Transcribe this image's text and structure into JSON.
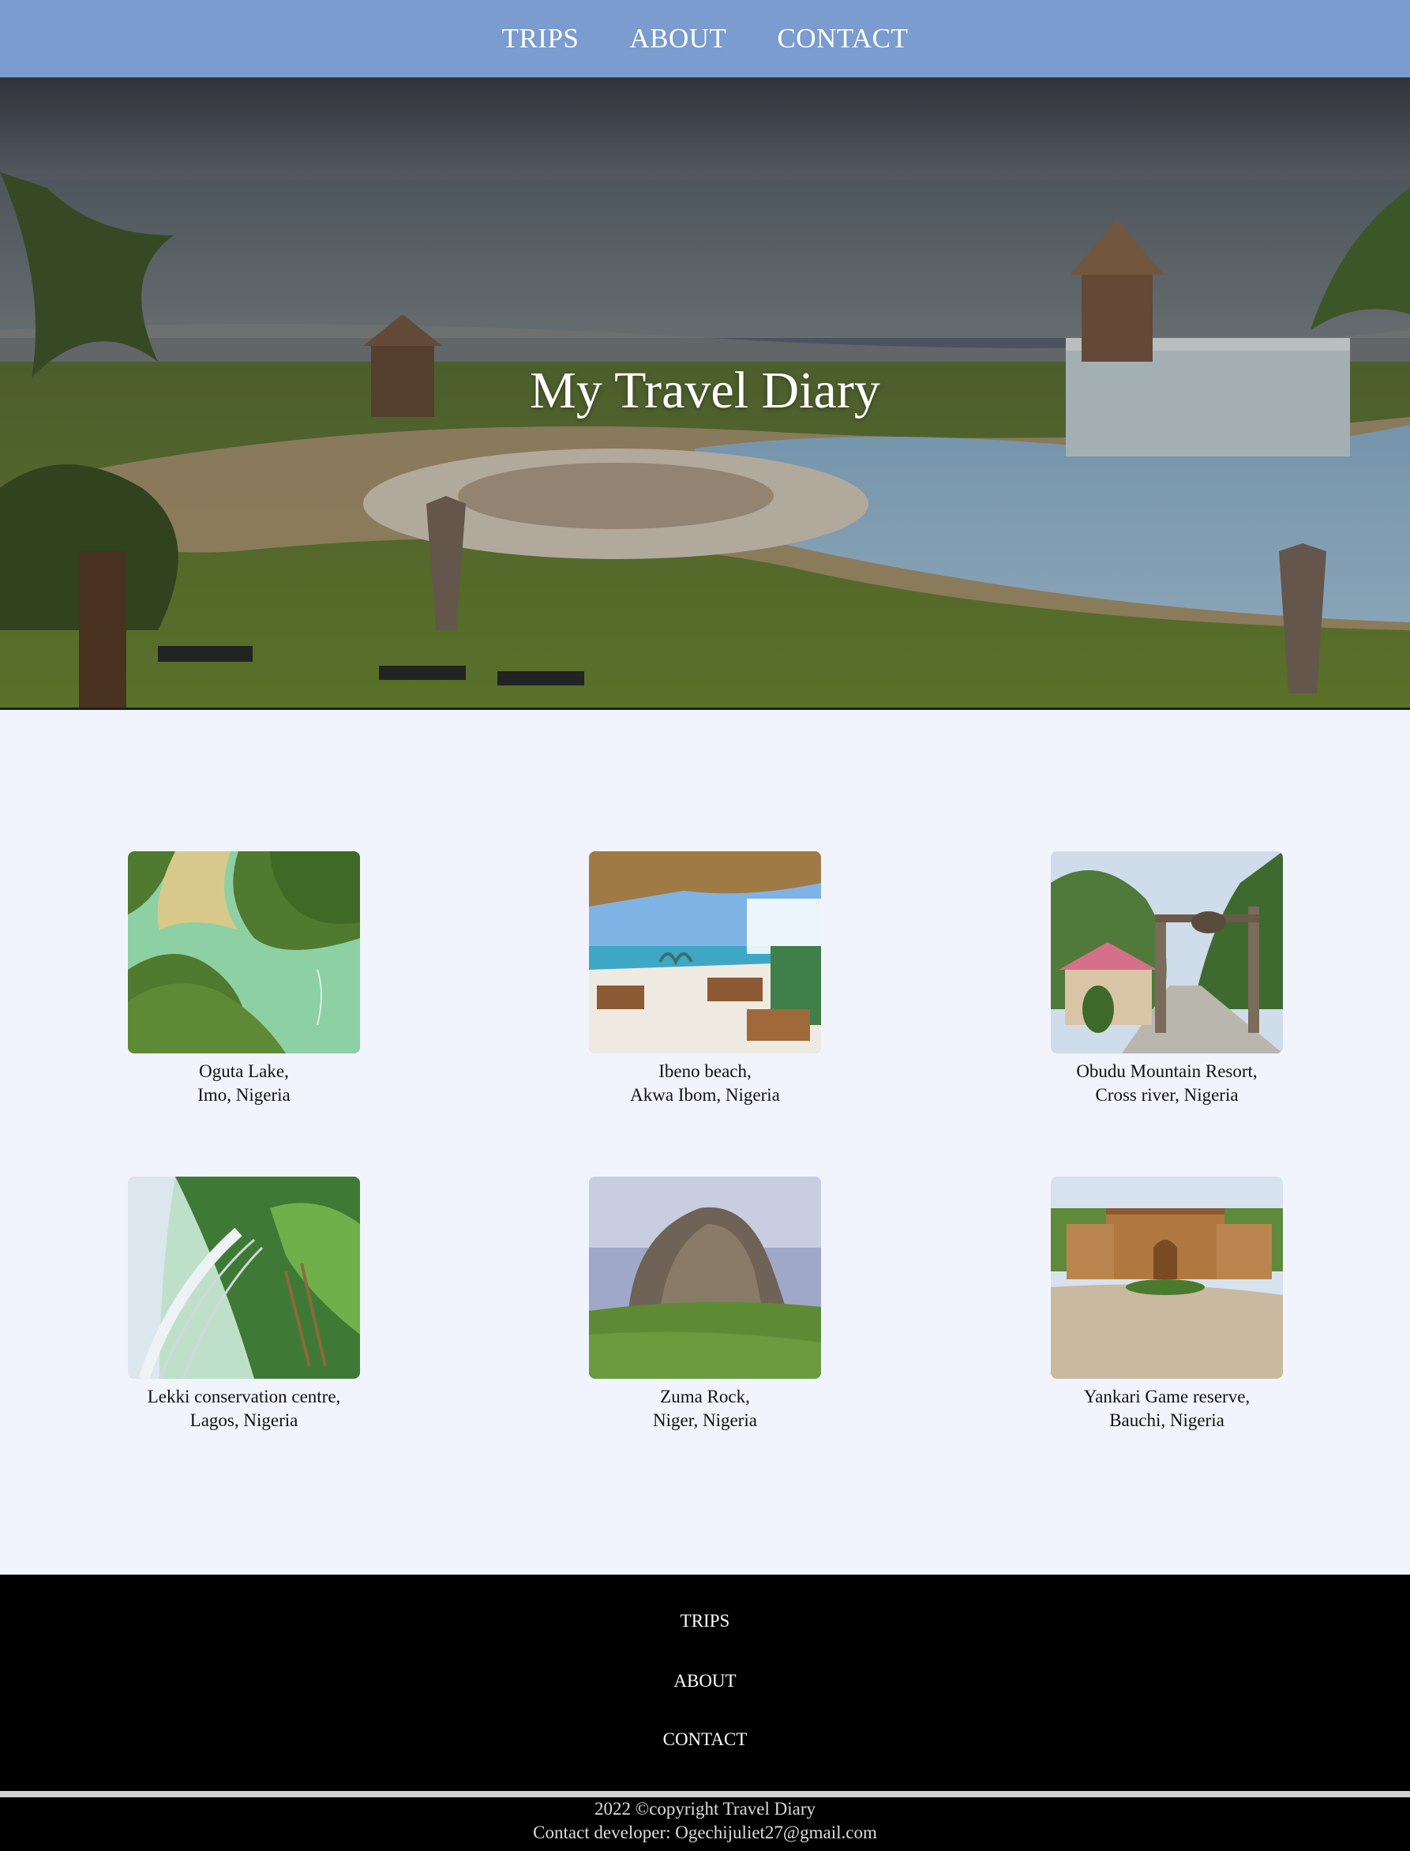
{
  "nav": {
    "items": [
      "TRIPS",
      "ABOUT",
      "CONTACT"
    ]
  },
  "hero": {
    "title": "My Travel Diary"
  },
  "trips": [
    {
      "name": "Oguta Lake,",
      "location": "Imo, Nigeria",
      "image": "aerial-lake-image"
    },
    {
      "name": "Ibeno beach,",
      "location": "Akwa Ibom, Nigeria",
      "image": "beach-hut-image"
    },
    {
      "name": "Obudu Mountain Resort,",
      "location": "Cross river, Nigeria",
      "image": "mountain-gate-image"
    },
    {
      "name": "Lekki conservation centre,",
      "location": "Lagos, Nigeria",
      "image": "canopy-walkway-image"
    },
    {
      "name": "Zuma Rock,",
      "location": "Niger, Nigeria",
      "image": "rock-landscape-image"
    },
    {
      "name": "Yankari Game reserve,",
      "location": "Bauchi, Nigeria",
      "image": "reserve-gate-image"
    }
  ],
  "footer": {
    "links": [
      "TRIPS",
      "ABOUT",
      "CONTACT"
    ],
    "copyright": "2022 ©copyright Travel Diary",
    "contact": "Contact developer: Ogechijuliet27@gmail.com"
  },
  "colors": {
    "nav_bg": "#7a9ccf",
    "page_bg": "#f1f4fd",
    "footer_bg": "#000000"
  }
}
